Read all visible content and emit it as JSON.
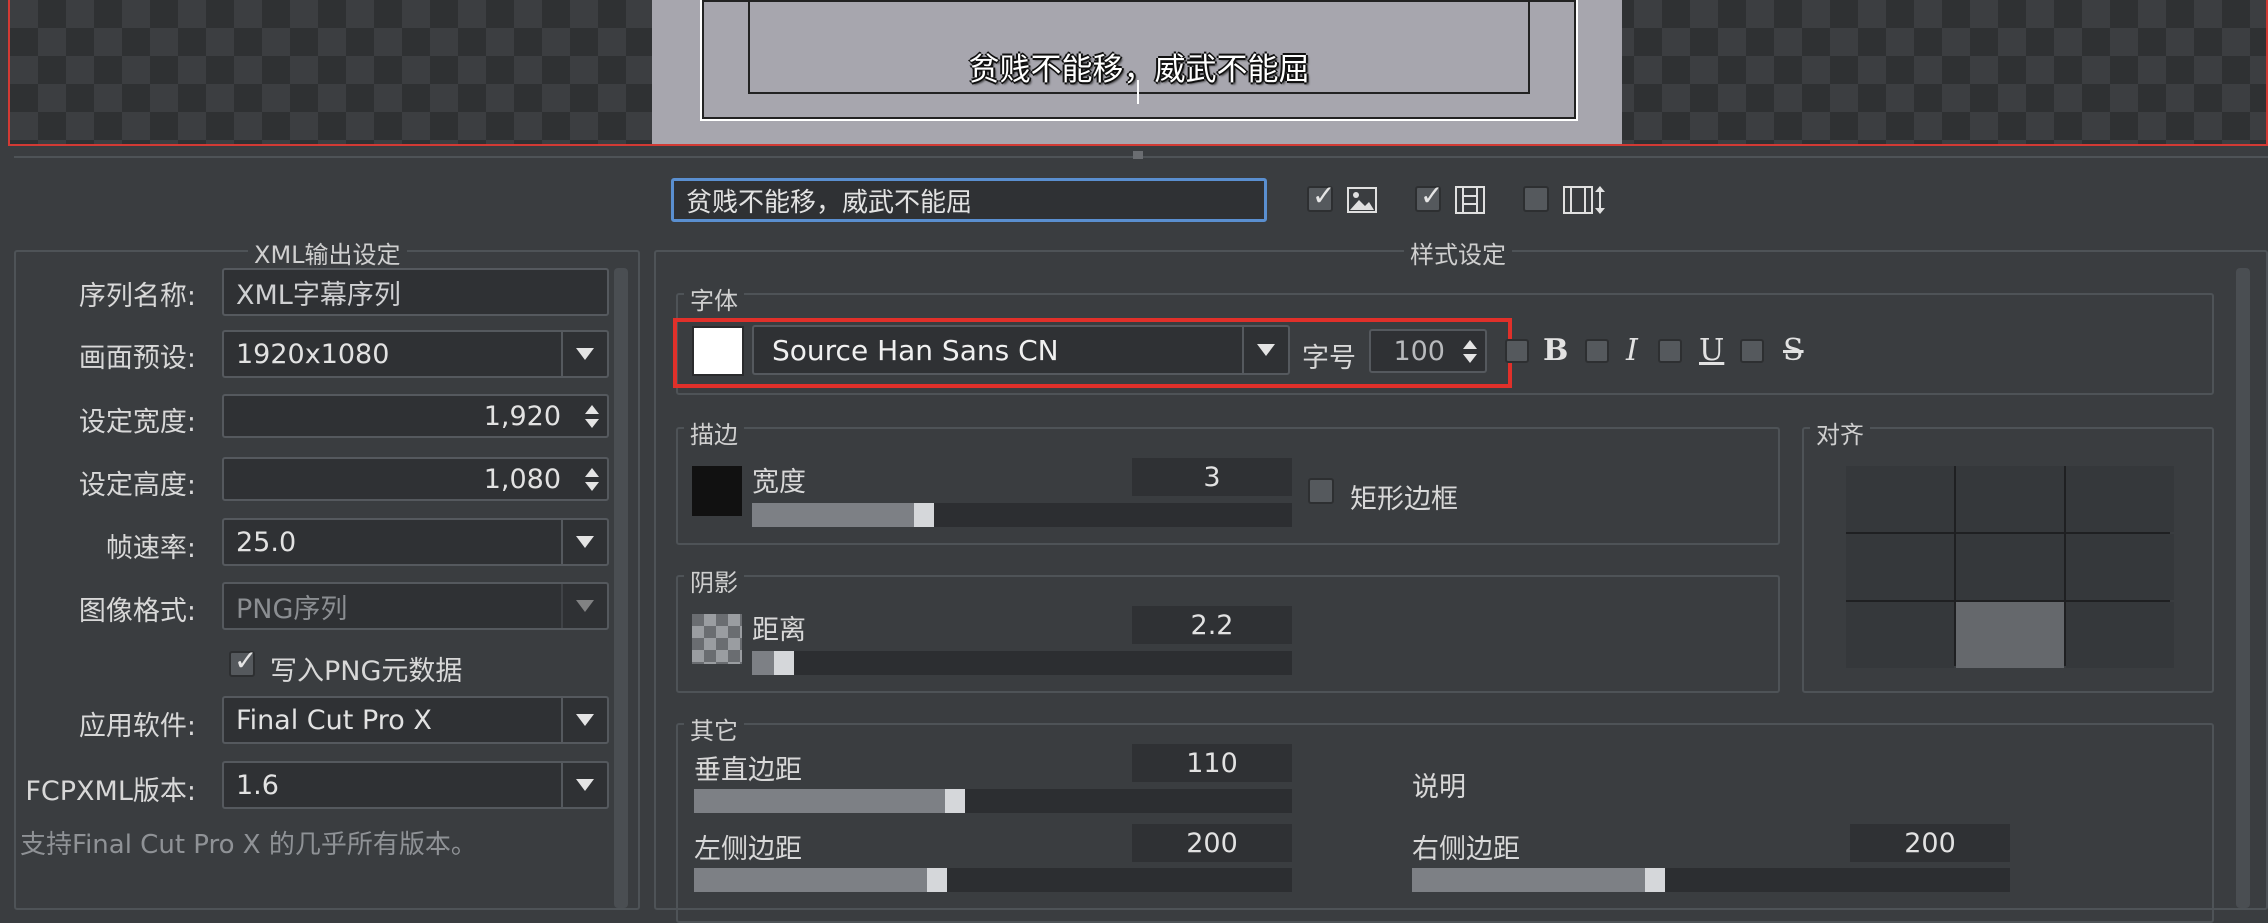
{
  "preview": {
    "subtitle_text": "贫贱不能移，威武不能屈"
  },
  "toolbar": {
    "text_input_value": "贫贱不能移，威武不能屈",
    "cb_image_checked": true,
    "cb_frame_checked": true,
    "cb_height_checked": false,
    "icon_image": "image-icon",
    "icon_frame": "film-frame-icon",
    "icon_height": "film-height-icon"
  },
  "xml_panel": {
    "title": "XML输出设定",
    "seq_name_label": "序列名称:",
    "seq_name_value": "XML字幕序列",
    "preset_label": "画面预设:",
    "preset_value": "1920x1080",
    "width_label": "设定宽度:",
    "width_value": "1,920",
    "height_label": "设定高度:",
    "height_value": "1,080",
    "fps_label": "帧速率:",
    "fps_value": "25.0",
    "format_label": "图像格式:",
    "format_value": "PNG序列",
    "png_meta_label": "写入PNG元数据",
    "png_meta_checked": true,
    "app_label": "应用软件:",
    "app_value": "Final Cut Pro X",
    "fcpxml_label": "FCPXML版本:",
    "fcpxml_value": "1.6",
    "note": "支持Final Cut Pro X 的几乎所有版本。"
  },
  "style_panel": {
    "title": "样式设定",
    "font_group": "字体",
    "font_color": "#ffffff",
    "font_name": "Source Han Sans CN",
    "size_label": "字号",
    "size_value": "100",
    "bold": "B",
    "italic": "I",
    "underline": "U",
    "strike": "S",
    "stroke_group": "描边",
    "stroke_width_label": "宽度",
    "stroke_width_value": "3",
    "stroke_slider": 0.3,
    "stroke_color": "#111111",
    "rect_border_label": "矩形边框",
    "shadow_group": "阴影",
    "shadow_dist_label": "距离",
    "shadow_dist_value": "2.2",
    "shadow_slider": 0.05,
    "align_group": "对齐",
    "align_selected": "bottom-center",
    "other_group": "其它",
    "vmargin_label": "垂直边距",
    "vmargin_value": "110",
    "vmargin_slider": 0.44,
    "desc_label": "说明",
    "left_margin_label": "左侧边距",
    "left_margin_value": "200",
    "left_margin_slider": 0.4,
    "right_margin_label": "右侧边距",
    "right_margin_value": "200",
    "right_margin_slider": 0.4
  },
  "colors": {
    "highlight_red": "#e0302a",
    "focus_blue": "#5a8fd0"
  }
}
